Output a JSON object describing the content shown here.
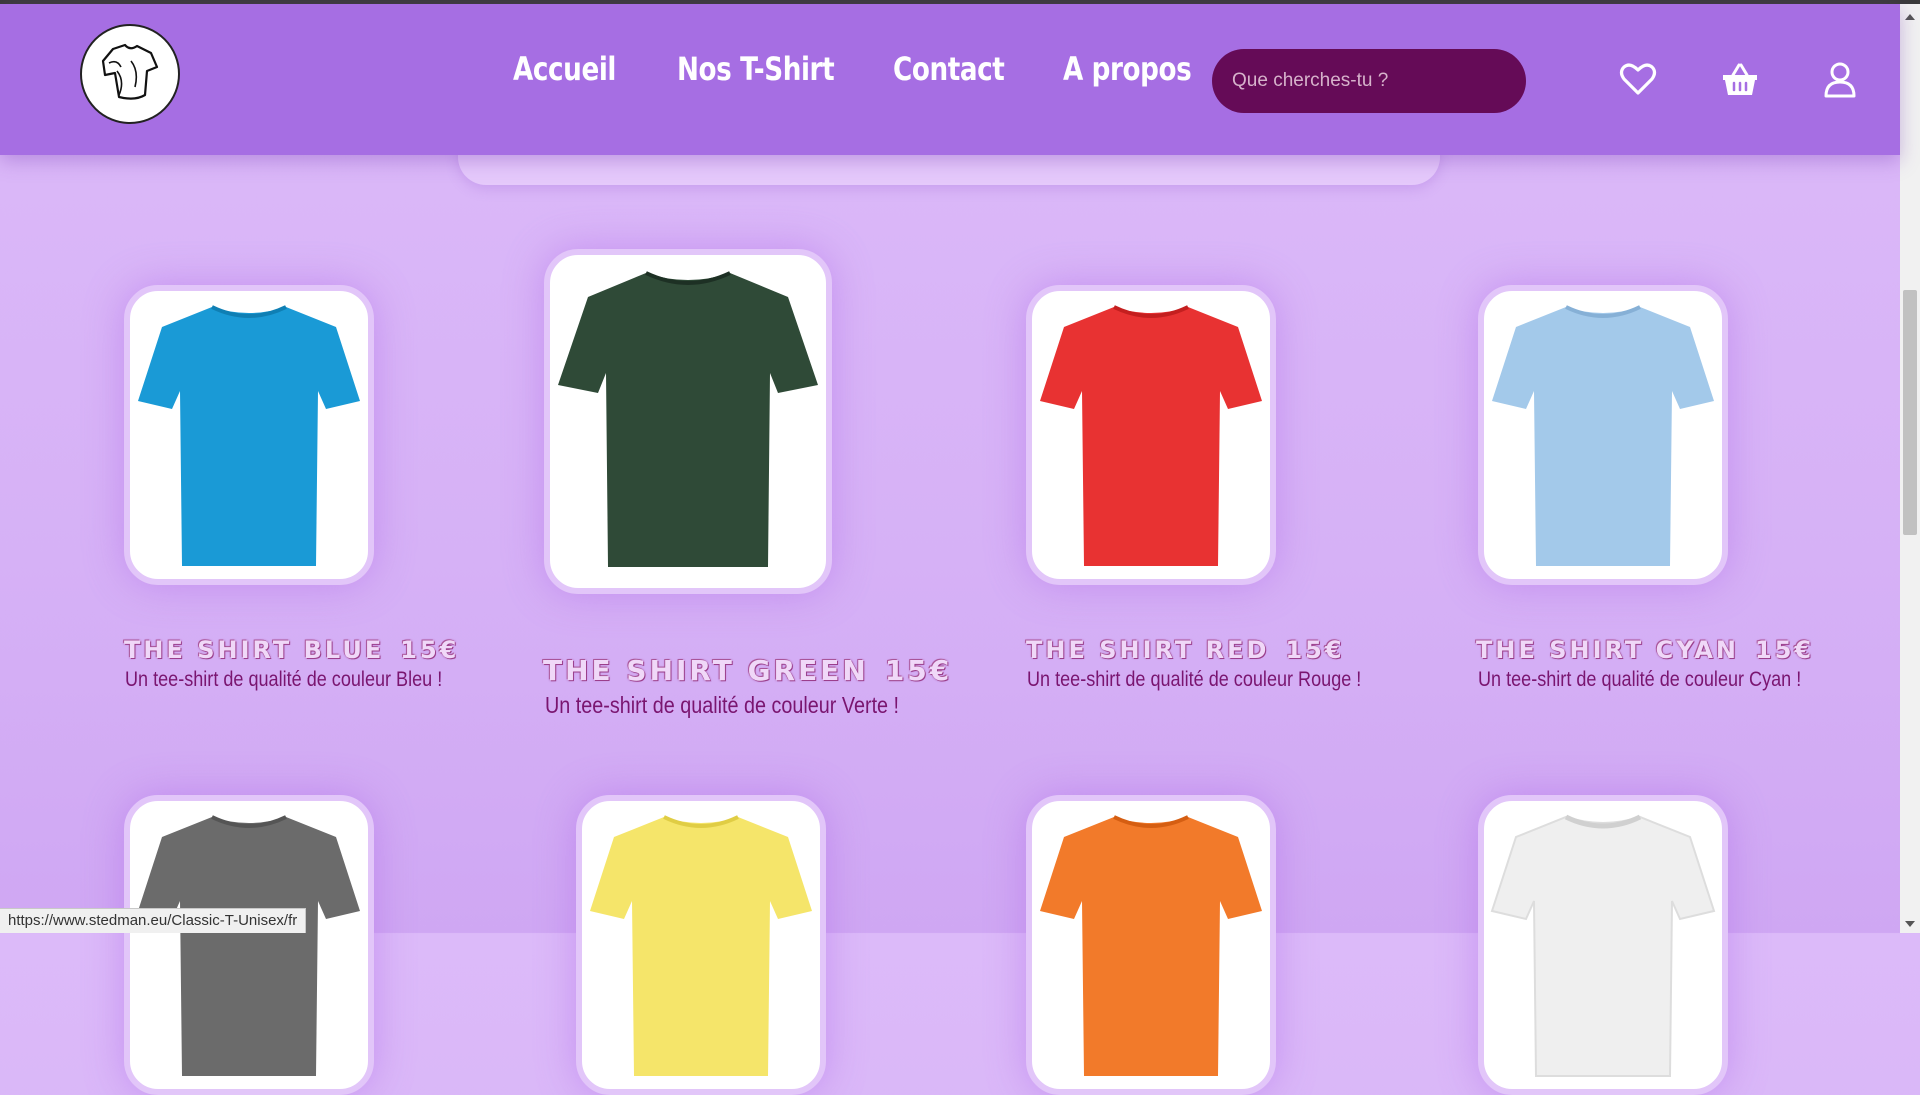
{
  "nav": {
    "home": "Accueil",
    "tshirts": "Nos T-Shirt",
    "contact": "Contact",
    "about": "A propos"
  },
  "search": {
    "placeholder": "Que cherches-tu ?"
  },
  "icons": {
    "logo": "tshirt-logo-icon",
    "favorites": "heart-icon",
    "cart": "basket-icon",
    "account": "user-icon"
  },
  "colors": {
    "header": "#a66ee3",
    "search": "#650b57",
    "background": "#d6b1f6",
    "description_text": "#7a1570"
  },
  "products": [
    {
      "name": "THE SHIRT BLUE",
      "price": "15€",
      "description": "Un tee-shirt de qualité de couleur Bleu !",
      "color": "#1a9ad6"
    },
    {
      "name": "THE SHIRT GREEN",
      "price": "15€",
      "description": "Un tee-shirt de qualité de couleur Verte !",
      "color": "#2f4a37"
    },
    {
      "name": "THE SHIRT RED",
      "price": "15€",
      "description": "Un tee-shirt de qualité de couleur Rouge !",
      "color": "#e83232"
    },
    {
      "name": "THE SHIRT CYAN",
      "price": "15€",
      "description": "Un tee-shirt de qualité de couleur Cyan !",
      "color": "#a3c9ea"
    }
  ],
  "products_row2": [
    {
      "color": "#6b6b6b"
    },
    {
      "color": "#f5e56a"
    },
    {
      "color": "#f27a2a"
    },
    {
      "color": "#f2f2f2"
    }
  ],
  "statusbar": {
    "url": "https://www.stedman.eu/Classic-T-Unisex/fr"
  }
}
